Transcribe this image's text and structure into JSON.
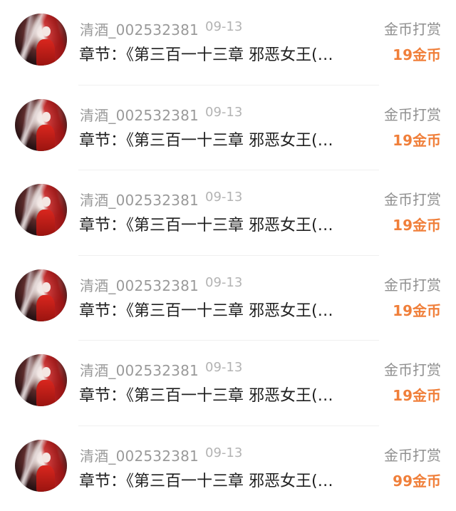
{
  "rows": [
    {
      "username": "清酒_002532381",
      "date": "09-13",
      "reward_type": "金币打赏",
      "chapter": "章节：《第三百一十三章  邪恶女王(…",
      "amount": "19金币"
    },
    {
      "username": "清酒_002532381",
      "date": "09-13",
      "reward_type": "金币打赏",
      "chapter": "章节：《第三百一十三章  邪恶女王(…",
      "amount": "19金币"
    },
    {
      "username": "清酒_002532381",
      "date": "09-13",
      "reward_type": "金币打赏",
      "chapter": "章节：《第三百一十三章  邪恶女王(…",
      "amount": "19金币"
    },
    {
      "username": "清酒_002532381",
      "date": "09-13",
      "reward_type": "金币打赏",
      "chapter": "章节：《第三百一十三章  邪恶女王(…",
      "amount": "19金币"
    },
    {
      "username": "清酒_002532381",
      "date": "09-13",
      "reward_type": "金币打赏",
      "chapter": "章节：《第三百一十三章  邪恶女王(…",
      "amount": "19金币"
    },
    {
      "username": "清酒_002532381",
      "date": "09-13",
      "reward_type": "金币打赏",
      "chapter": "章节：《第三百一十三章  邪恶女王(…",
      "amount": "99金币"
    }
  ],
  "colors": {
    "amount": "#f07f3a",
    "username": "#9a9a9a",
    "chapter": "#1f1f1f"
  }
}
